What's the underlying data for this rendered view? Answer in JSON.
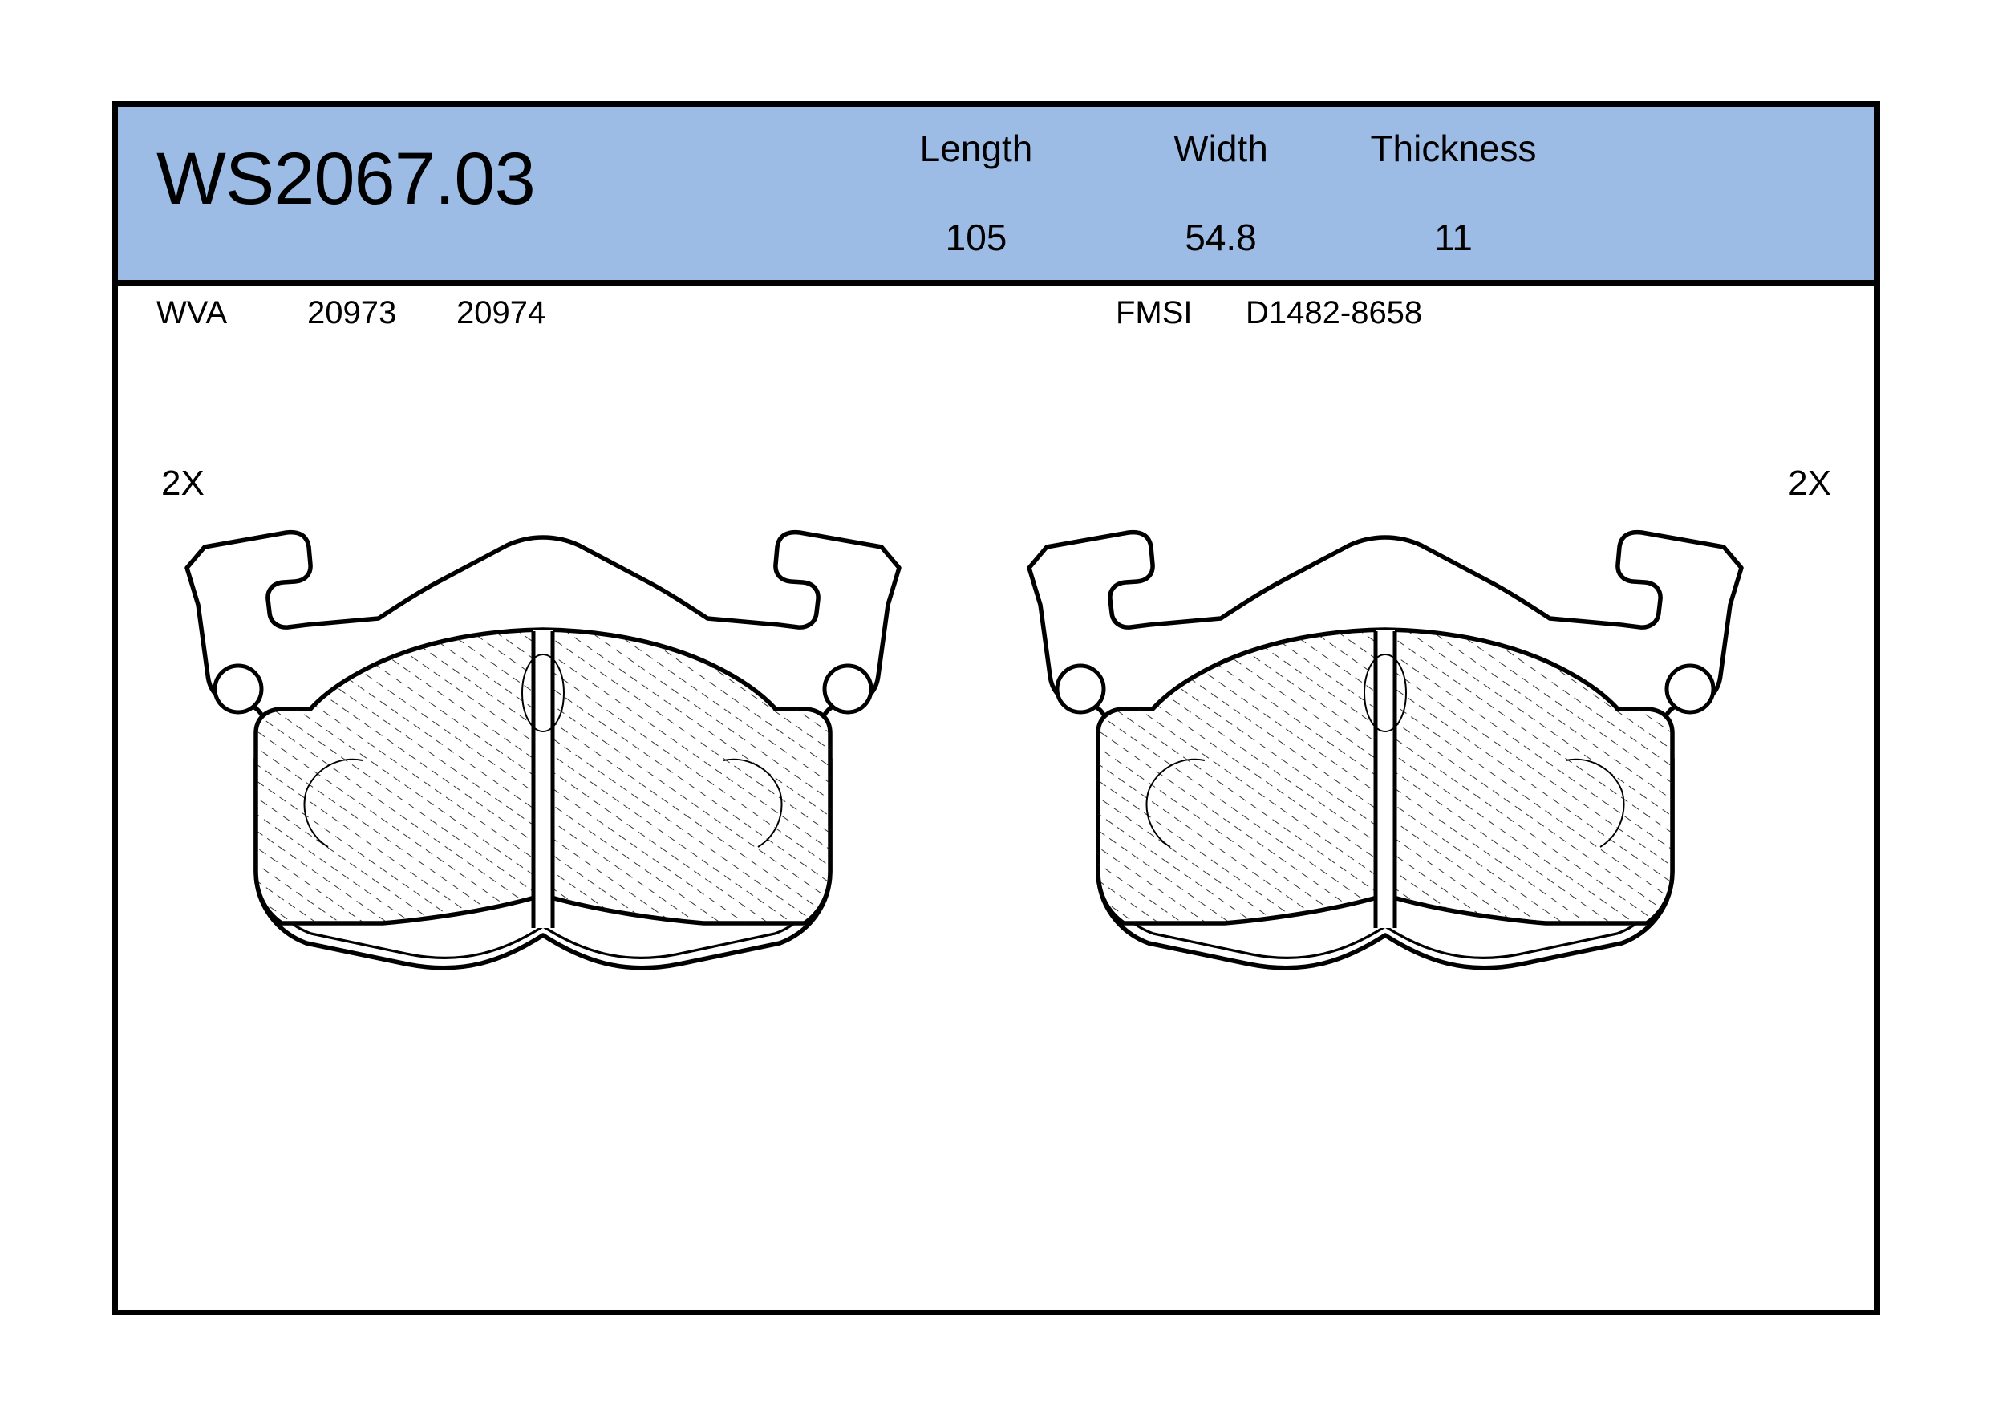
{
  "document": {
    "type": "technical-product-drawing",
    "subject": "disc brake pad set"
  },
  "header": {
    "part_number": "WS2067.03",
    "band_color": "#9cbce6",
    "specs": [
      {
        "label": "Length",
        "value": "105"
      },
      {
        "label": "Width",
        "value": "54.8"
      },
      {
        "label": "Thickness",
        "value": "11"
      }
    ]
  },
  "codes": {
    "wva": {
      "key": "WVA",
      "values": [
        "20973",
        "20974"
      ]
    },
    "fmsi": {
      "key": "FMSI",
      "value": "D1482-8658"
    }
  },
  "drawing": {
    "quantity_left": "2X",
    "quantity_right": "2X",
    "pads": [
      {
        "name": "brake-pad-left",
        "quantity": "2X"
      },
      {
        "name": "brake-pad-right",
        "quantity": "2X"
      }
    ],
    "stroke_color": "#000000",
    "hatch_color": "#000000",
    "fill_color": "#ffffff"
  }
}
